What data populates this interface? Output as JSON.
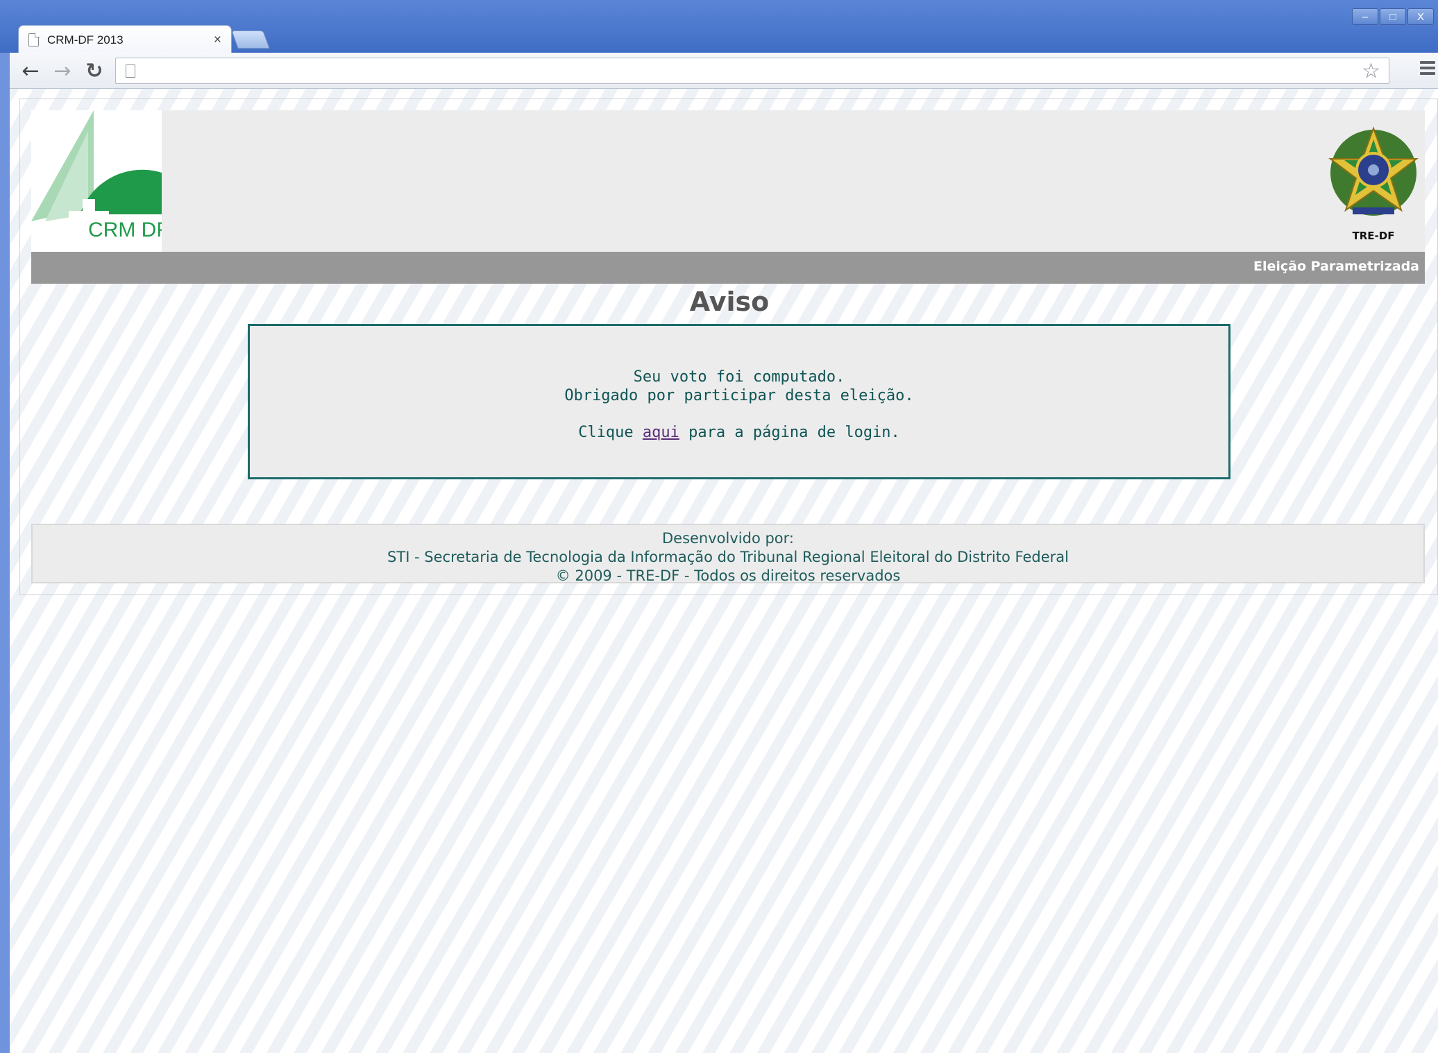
{
  "browser": {
    "tab_title": "CRM-DF 2013",
    "tab_close": "×",
    "window_controls": [
      "–",
      "□",
      "X"
    ],
    "icons": [
      "back-arrow-icon",
      "forward-arrow-icon",
      "reload-icon",
      "page-icon",
      "star-icon",
      "menu-icon"
    ]
  },
  "header": {
    "logo_text": "CRM DF",
    "tre_label": "TRE-DF",
    "banner_text": "Eleição Parametrizada"
  },
  "main": {
    "title": "Aviso",
    "message_line1": "Seu voto foi computado.",
    "message_line2": "Obrigado por participar desta eleição.",
    "login_prefix": "Clique",
    "login_link": "aqui",
    "login_suffix": "para a página de login."
  },
  "footer": {
    "line1": "Desenvolvido por:",
    "line2": "STI - Secretaria de Tecnologia da Informação do Tribunal Regional Eleitoral do Distrito Federal",
    "line3": "© 2009 - TRE-DF - Todos os direitos reservados"
  },
  "colors": {
    "crm_green": "#1f9a4a",
    "crm_light_green": "#a9d8b5",
    "teal": "#1c6b6b",
    "banner_gray": "#979797"
  }
}
